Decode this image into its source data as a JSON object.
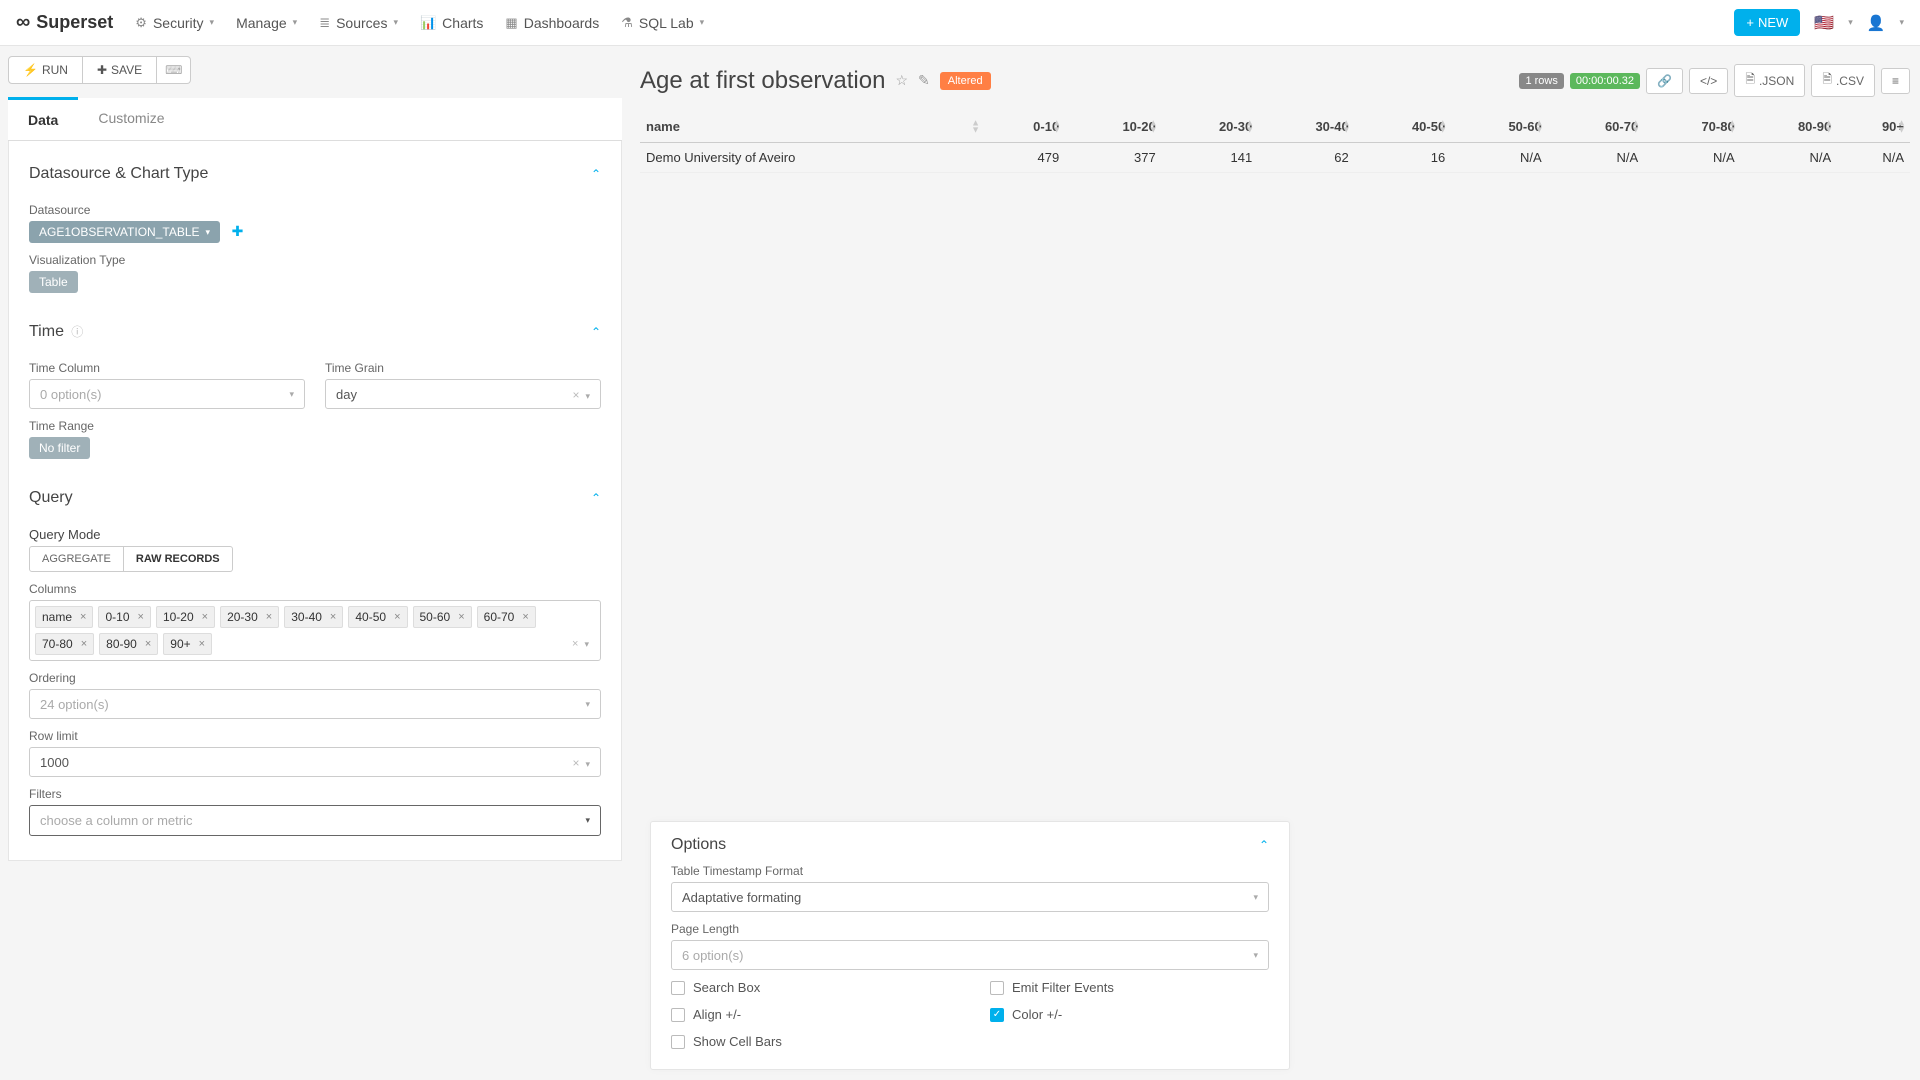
{
  "brand": "Superset",
  "nav": {
    "security": "Security",
    "manage": "Manage",
    "sources": "Sources",
    "charts": "Charts",
    "dashboards": "Dashboards",
    "sqllab": "SQL Lab",
    "new": "NEW"
  },
  "actions": {
    "run": "RUN",
    "save": "SAVE"
  },
  "tabs": {
    "data": "Data",
    "customize": "Customize"
  },
  "sections": {
    "datasource_chart_type": "Datasource & Chart Type",
    "time": "Time",
    "query": "Query"
  },
  "datasource": {
    "label": "Datasource",
    "value": "AGE1OBSERVATION_TABLE",
    "viz_label": "Visualization Type",
    "viz_value": "Table"
  },
  "time": {
    "column_label": "Time Column",
    "column_placeholder": "0 option(s)",
    "grain_label": "Time Grain",
    "grain_value": "day",
    "range_label": "Time Range",
    "range_value": "No filter"
  },
  "query": {
    "mode_label": "Query Mode",
    "mode_aggregate": "AGGREGATE",
    "mode_raw": "RAW RECORDS",
    "columns_label": "Columns",
    "columns": [
      "name",
      "0-10",
      "10-20",
      "20-30",
      "30-40",
      "40-50",
      "50-60",
      "60-70",
      "70-80",
      "80-90",
      "90+"
    ],
    "ordering_label": "Ordering",
    "ordering_placeholder": "24 option(s)",
    "rowlimit_label": "Row limit",
    "rowlimit_value": "1000",
    "filters_label": "Filters",
    "filters_placeholder": "choose a column or metric"
  },
  "chart": {
    "title": "Age at first observation",
    "altered": "Altered",
    "rows_badge": "1 rows",
    "time_badge": "00:00:00.32",
    "json": ".JSON",
    "csv": ".CSV"
  },
  "table": {
    "headers": [
      "name",
      "0-10",
      "10-20",
      "20-30",
      "30-40",
      "40-50",
      "50-60",
      "60-70",
      "70-80",
      "80-90",
      "90+"
    ],
    "row": {
      "name": "Demo University of Aveiro",
      "c0": "479",
      "c1": "377",
      "c2": "141",
      "c3": "62",
      "c4": "16",
      "c5": "N/A",
      "c6": "N/A",
      "c7": "N/A",
      "c8": "N/A",
      "c9": "N/A"
    }
  },
  "options": {
    "title": "Options",
    "ts_format_label": "Table Timestamp Format",
    "ts_format_value": "Adaptative formating",
    "pagelen_label": "Page Length",
    "pagelen_placeholder": "6 option(s)",
    "search_box": "Search Box",
    "align": "Align +/-",
    "show_cell_bars": "Show Cell Bars",
    "emit_filter": "Emit Filter Events",
    "color": "Color +/-"
  }
}
